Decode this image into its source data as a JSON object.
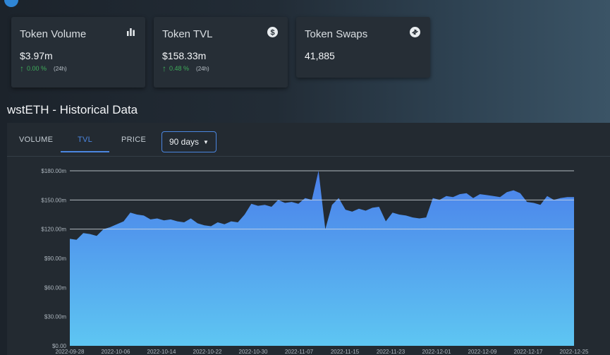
{
  "cards": [
    {
      "title": "Token Volume",
      "value": "$3.97m",
      "change": "0.00 %",
      "period": "(24h)",
      "icon": "bar-chart-icon"
    },
    {
      "title": "Token TVL",
      "value": "$158.33m",
      "change": "0.48 %",
      "period": "(24h)",
      "icon": "dollar-circle-icon"
    },
    {
      "title": "Token Swaps",
      "value": "41,885",
      "icon": "swap-circle-icon"
    }
  ],
  "section": {
    "title": "wstETH - Historical Data"
  },
  "tabs": [
    {
      "label": "VOLUME",
      "active": false
    },
    {
      "label": "TVL",
      "active": true
    },
    {
      "label": "PRICE",
      "active": false
    }
  ],
  "range": {
    "selected": "90 days"
  },
  "colors": {
    "accent": "#4b86e0",
    "positive": "#3fae5b",
    "area_top": "#4a7fea",
    "area_bottom": "#5ec6f2"
  },
  "chart_data": {
    "type": "area",
    "title": "",
    "xlabel": "",
    "ylabel": "",
    "ylim": [
      0,
      180
    ],
    "y_ticks": [
      "$0.00",
      "$30.00m",
      "$60.00m",
      "$90.00m",
      "$120.00m",
      "$150.00m",
      "$180.00m"
    ],
    "y_tick_values": [
      0,
      30,
      60,
      90,
      120,
      150,
      180
    ],
    "x_ticks": [
      "2022-09-28",
      "2022-10-06",
      "2022-10-14",
      "2022-10-22",
      "2022-10-30",
      "2022-11-07",
      "2022-11-15",
      "2022-11-23",
      "2022-12-01",
      "2022-12-09",
      "2022-12-17",
      "2022-12-25"
    ],
    "grid": "horizontal at 120, 150, 180",
    "series": [
      {
        "values": [
          110,
          109,
          116,
          115,
          113,
          120,
          122,
          125,
          128,
          137,
          135,
          134,
          130,
          131,
          129,
          130,
          128,
          127,
          131,
          126,
          124,
          123,
          127,
          125,
          128,
          127,
          135,
          146,
          144,
          145,
          143,
          150,
          147,
          148,
          146,
          152,
          150,
          180,
          120,
          145,
          152,
          140,
          138,
          141,
          139,
          142,
          143,
          128,
          137,
          135,
          134,
          132,
          131,
          132,
          152,
          150,
          154,
          153,
          156,
          157,
          152,
          156,
          155,
          154,
          153,
          158,
          160,
          157,
          148,
          147,
          145,
          154,
          150,
          152,
          153,
          153
        ]
      }
    ]
  }
}
